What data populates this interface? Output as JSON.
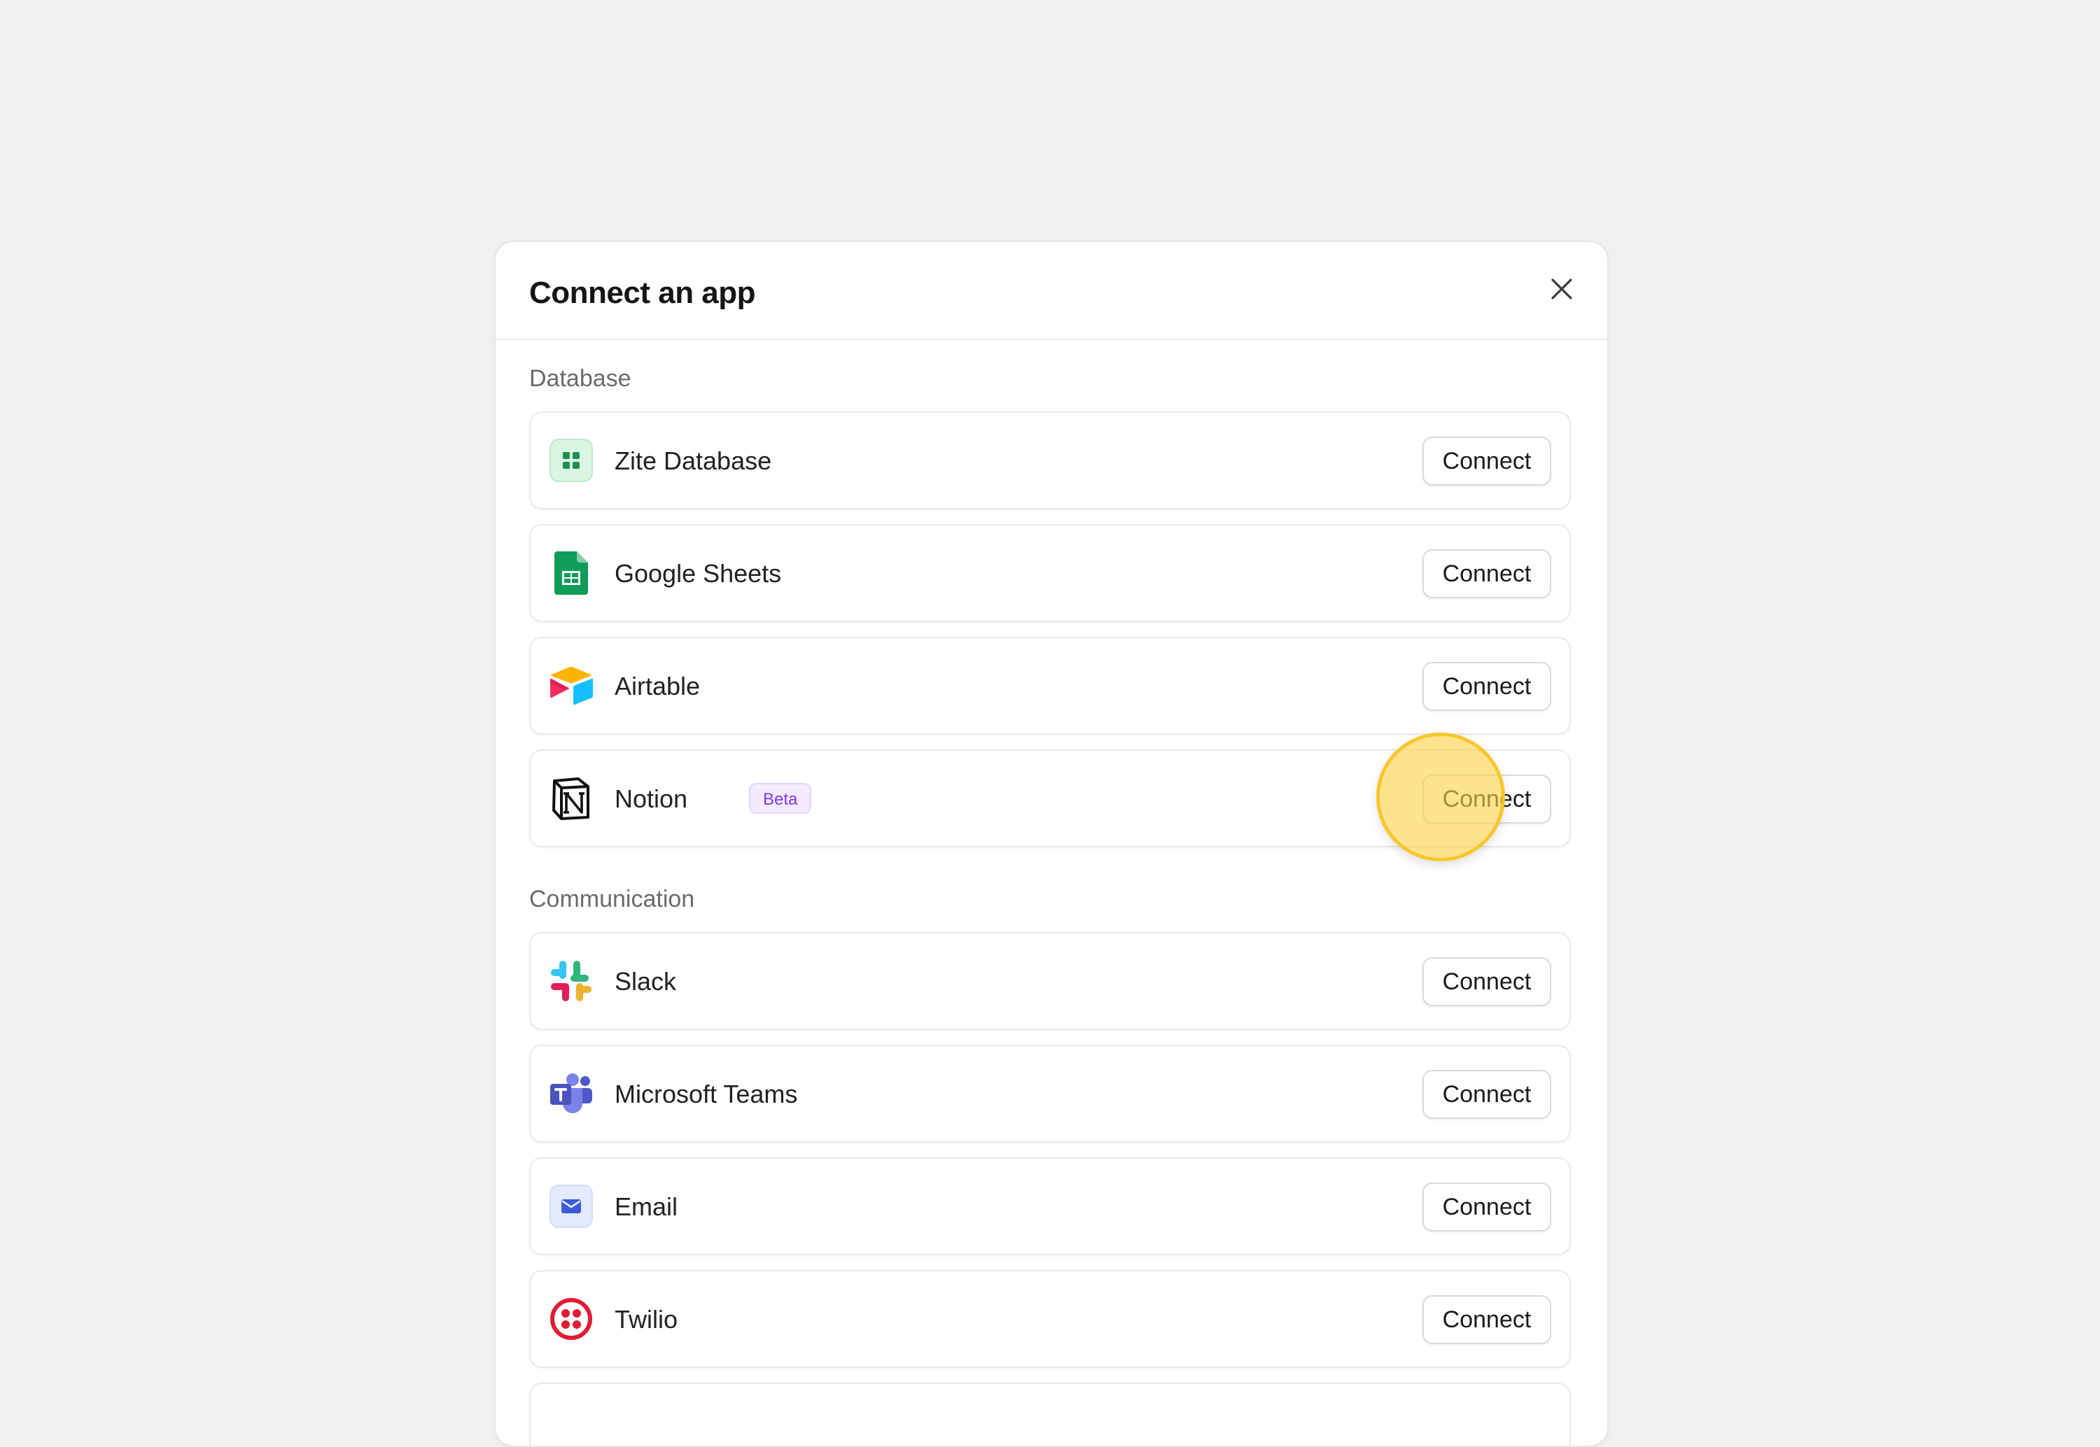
{
  "modal": {
    "title": "Connect an app"
  },
  "sections": {
    "database": {
      "label": "Database",
      "items": [
        {
          "name": "Zite Database",
          "button": "Connect"
        },
        {
          "name": "Google Sheets",
          "button": "Connect"
        },
        {
          "name": "Airtable",
          "button": "Connect"
        },
        {
          "name": "Notion",
          "badge": "Beta",
          "button": "Connect"
        }
      ]
    },
    "communication": {
      "label": "Communication",
      "items": [
        {
          "name": "Slack",
          "button": "Connect"
        },
        {
          "name": "Microsoft Teams",
          "button": "Connect"
        },
        {
          "name": "Email",
          "button": "Connect"
        },
        {
          "name": "Twilio",
          "button": "Connect"
        }
      ]
    }
  },
  "icons": {
    "close": "close-icon",
    "zite": "zite-database-icon",
    "sheets": "google-sheets-icon",
    "airtable": "airtable-icon",
    "notion": "notion-icon",
    "slack": "slack-icon",
    "teams": "microsoft-teams-icon",
    "email": "email-icon",
    "twilio": "twilio-icon"
  },
  "colors": {
    "background": "#f1f1f1",
    "zite_green": "#1e8f4e",
    "sheets_green": "#0f9d58",
    "beta_purple": "#7c3aed",
    "teams_purple": "#5059c9",
    "email_blue": "#3b5bdb",
    "twilio_red": "#e11d35",
    "highlight_yellow": "#ffd146"
  }
}
